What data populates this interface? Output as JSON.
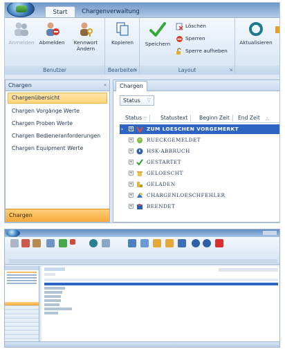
{
  "ribbon": {
    "tabs": [
      {
        "label": "Start",
        "active": true
      },
      {
        "label": "Chargenverwaltung",
        "active": false
      }
    ],
    "groups": {
      "benutzer": {
        "title": "Benutzer",
        "buttons": [
          {
            "label": "Anmelden",
            "disabled": true,
            "icon": "users-icon"
          },
          {
            "label": "Abmelden",
            "disabled": false,
            "icon": "user-logout-icon"
          },
          {
            "label": "Kennwort Ändern",
            "disabled": false,
            "icon": "user-key-icon"
          }
        ]
      },
      "bearbeiten": {
        "title": "Bearbeiten",
        "buttons": [
          {
            "label": "Kopieren",
            "icon": "copy-icon"
          }
        ]
      },
      "layout": {
        "title": "Layout",
        "buttons": [
          {
            "label": "Speichern",
            "icon": "checkmark-icon"
          }
        ],
        "small_buttons": [
          {
            "label": "Löschen",
            "icon": "delete-doc-icon"
          },
          {
            "label": "Sperren",
            "icon": "no-entry-icon"
          },
          {
            "label": "Sperre aufheben",
            "icon": "unlock-icon"
          }
        ]
      },
      "more": {
        "buttons": [
          {
            "label": "Aktualisieren",
            "icon": "refresh-icon"
          }
        ]
      }
    }
  },
  "left_pane": {
    "header": "Chargen",
    "items": [
      {
        "label": "Chargenübersicht",
        "selected": true
      },
      {
        "label": "Chargen Vorgänge Werte",
        "selected": false
      },
      {
        "label": "Chargen Proben Werte",
        "selected": false
      },
      {
        "label": "Chargen Bedieneranforderungen",
        "selected": false
      },
      {
        "label": "Chargen Equipment Werte",
        "selected": false
      }
    ],
    "footer": "Chargen"
  },
  "main": {
    "tab": "Chargen",
    "group_box": "Status",
    "columns": [
      "Status",
      "Statustext",
      "Beginn Zeit",
      "End Zeit"
    ],
    "rows": [
      {
        "label": "ZUM LOESCHEN VORGEMERKT",
        "icon": "delete-mark-icon",
        "color": "#d03030",
        "selected": true
      },
      {
        "label": "RUECKGEMELDET",
        "icon": "feedback-icon",
        "color": "#6aa843",
        "selected": false
      },
      {
        "label": "HSK-ABBRUCH",
        "icon": "help-circle-icon",
        "color": "#2e5fa8",
        "selected": false
      },
      {
        "label": "GESTARTET",
        "icon": "checkmark-icon",
        "color": "#2e9a34",
        "selected": false
      },
      {
        "label": "GELOESCHT",
        "icon": "trash-icon",
        "color": "#e5a92a",
        "selected": false
      },
      {
        "label": "GELADEN",
        "icon": "loaded-icon",
        "color": "#e3b53c",
        "selected": false
      },
      {
        "label": "CHARGENLOESCHFEHLER",
        "icon": "error-icon",
        "color": "#3a6fc4",
        "selected": false
      },
      {
        "label": "BEENDET",
        "icon": "finish-icon",
        "color": "#2d5fb0",
        "selected": false
      }
    ]
  },
  "colors": {
    "selection": "#2e64c4",
    "accent_orange": "#f6a93a",
    "ribbon_blue": "#dfe9f5"
  }
}
